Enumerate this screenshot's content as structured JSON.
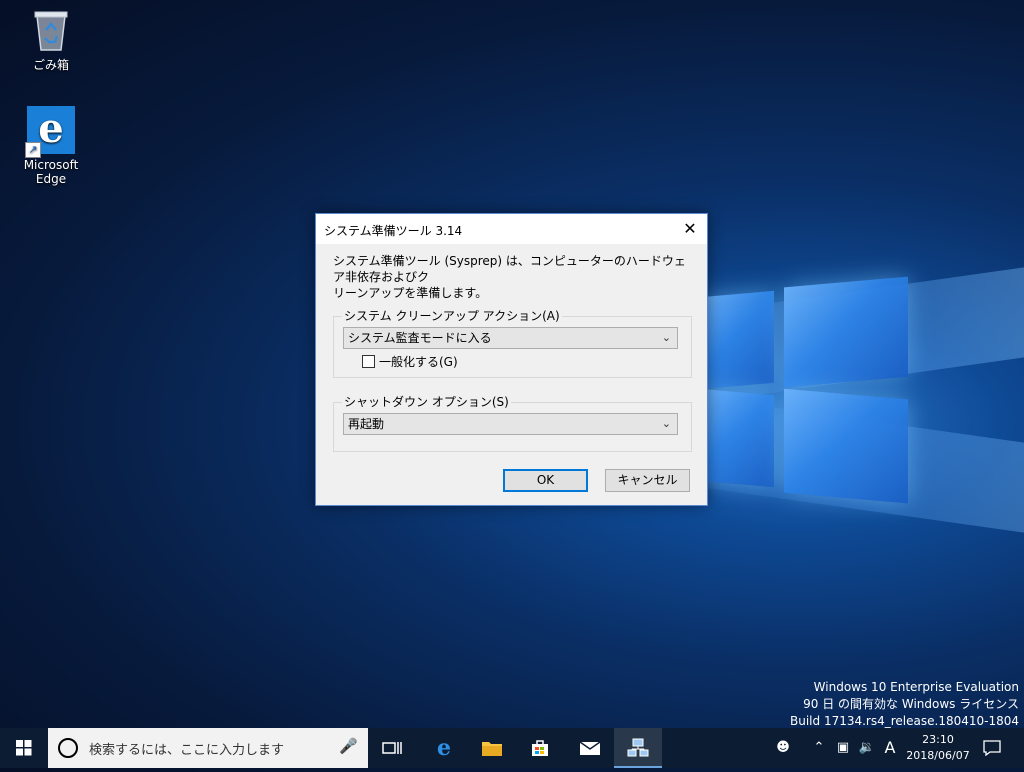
{
  "desktop": {
    "icons": [
      {
        "label": "ごみ箱",
        "icon": "recycle-bin-icon"
      },
      {
        "label": "Microsoft Edge",
        "icon": "edge-icon"
      }
    ]
  },
  "dialog": {
    "title": "システム準備ツール 3.14",
    "close_symbol": "✕",
    "description_line1": "システム準備ツール (Sysprep) は、コンピューターのハードウェア非依存およびク",
    "description_line2": "リーンアップを準備します。",
    "cleanup_group_label": "システム クリーンアップ アクション(A)",
    "cleanup_selected": "システム監査モードに入る",
    "generalize_label": "一般化する(G)",
    "generalize_checked": false,
    "shutdown_group_label": "シャットダウン オプション(S)",
    "shutdown_selected": "再起動",
    "ok_label": "OK",
    "cancel_label": "キャンセル"
  },
  "watermark": {
    "line1": "Windows 10 Enterprise Evaluation",
    "line2": "90 日 の間有効な Windows ライセンス",
    "line3": "Build 17134.rs4_release.180410-1804"
  },
  "taskbar": {
    "search_placeholder": "検索するには、ここに入力します",
    "ime_label": "A",
    "time": "23:10",
    "date": "2018/06/07"
  },
  "colors": {
    "accent": "#0078d7",
    "taskbar": "#0c1d33",
    "dialog_bg": "#f0f0f0"
  }
}
